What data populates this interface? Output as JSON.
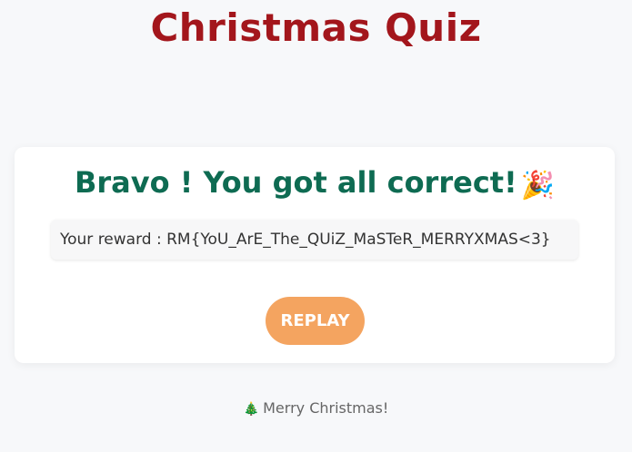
{
  "header": {
    "title": "Christmas Quiz"
  },
  "result": {
    "heading": "Bravo ! You got all correct!",
    "heading_icon": "party-popper-icon",
    "reward_text": "Your reward : RM{YoU_ArE_The_QUiZ_MaSTeR_MERRYXMAS<3}",
    "replay_label": "REPLAY"
  },
  "footer": {
    "icon": "christmas-tree-icon",
    "text": "Merry Christmas!"
  },
  "colors": {
    "title": "#a3161c",
    "heading": "#0e6b52",
    "replay_button": "#f4a460",
    "background": "#f7f8fa"
  }
}
